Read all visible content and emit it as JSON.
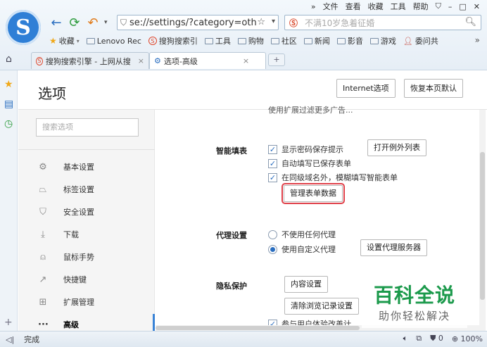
{
  "menubar": [
    "»",
    "文件",
    "查看",
    "收藏",
    "工具",
    "帮助",
    "⛉",
    "–",
    "□",
    "✕"
  ],
  "logo": "S",
  "address": {
    "value": "se://settings/?category=oth"
  },
  "search": {
    "placeholder": "不满10岁急着征婚"
  },
  "bookmarks": [
    {
      "label": "收藏",
      "type": "star"
    },
    {
      "label": "Lenovo Rec",
      "type": "folder"
    },
    {
      "label": "搜狗搜索引",
      "type": "sogou"
    },
    {
      "label": "工具",
      "type": "folder"
    },
    {
      "label": "购物",
      "type": "folder"
    },
    {
      "label": "社区",
      "type": "folder"
    },
    {
      "label": "新闻",
      "type": "folder"
    },
    {
      "label": "影音",
      "type": "folder"
    },
    {
      "label": "游戏",
      "type": "folder"
    },
    {
      "label": "委问共",
      "type": "avatar"
    }
  ],
  "tabs": [
    {
      "label": "搜狗搜索引擎 - 上网从搜"
    },
    {
      "label": "选项-高级"
    }
  ],
  "settings": {
    "title": "选项",
    "internet_btn": "Internet选项",
    "restore_btn": "恢复本页默认",
    "search_placeholder": "搜索选项",
    "nav": [
      {
        "label": "基本设置",
        "icon": "gear-icon"
      },
      {
        "label": "标签设置",
        "icon": "tab-icon"
      },
      {
        "label": "安全设置",
        "icon": "shield-icon"
      },
      {
        "label": "下载",
        "icon": "download-icon"
      },
      {
        "label": "鼠标手势",
        "icon": "mouse-icon"
      },
      {
        "label": "快捷键",
        "icon": "shortcut-icon"
      },
      {
        "label": "扩展管理",
        "icon": "extension-icon"
      },
      {
        "label": "高级",
        "icon": "more-icon"
      }
    ],
    "cut_text": "使用扩展过滤更多广告...",
    "autofill": {
      "title": "智能填表",
      "opt1": "显示密码保存提示",
      "exception_btn": "打开例外列表",
      "opt2": "自动填写已保存表单",
      "opt3": "在同级域名外，模糊填写智能表单",
      "manage_btn": "管理表单数据"
    },
    "proxy": {
      "title": "代理设置",
      "opt1": "不使用任何代理",
      "opt2": "使用自定义代理",
      "proxy_btn": "设置代理服务器"
    },
    "privacy": {
      "title": "隐私保护",
      "content_btn": "内容设置",
      "clear_btn": "清除浏览记录设置",
      "opt1": "参与用户体验改善计"
    }
  },
  "watermark": {
    "main": "百科全说",
    "sub": "助你轻松解决"
  },
  "status": {
    "left": "完成",
    "count": "0",
    "zoom": "100%"
  }
}
